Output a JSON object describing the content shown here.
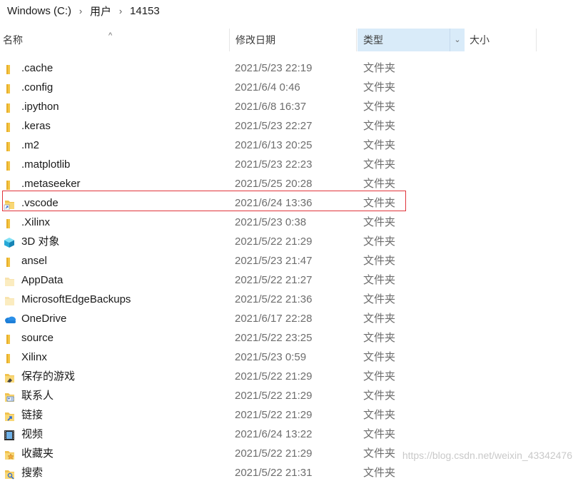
{
  "breadcrumb": [
    "Windows (C:)",
    "用户",
    "14153"
  ],
  "breadcrumb_sep": "›",
  "columns": {
    "name": "名称",
    "date": "修改日期",
    "type": "类型",
    "size": "大小"
  },
  "sort_caret": "^",
  "dropdown_glyph": "⌄",
  "rows": [
    {
      "name": ".cache",
      "date": "2021/5/23 22:19",
      "type": "文件夹",
      "icon": "folder-icon"
    },
    {
      "name": ".config",
      "date": "2021/6/4 0:46",
      "type": "文件夹",
      "icon": "folder-icon"
    },
    {
      "name": ".ipython",
      "date": "2021/6/8 16:37",
      "type": "文件夹",
      "icon": "folder-icon"
    },
    {
      "name": ".keras",
      "date": "2021/5/23 22:27",
      "type": "文件夹",
      "icon": "folder-icon"
    },
    {
      "name": ".m2",
      "date": "2021/6/13 20:25",
      "type": "文件夹",
      "icon": "folder-icon"
    },
    {
      "name": ".matplotlib",
      "date": "2021/5/23 22:23",
      "type": "文件夹",
      "icon": "folder-icon"
    },
    {
      "name": ".metaseeker",
      "date": "2021/5/25 20:28",
      "type": "文件夹",
      "icon": "folder-icon"
    },
    {
      "name": ".vscode",
      "date": "2021/6/24 13:36",
      "type": "文件夹",
      "icon": "folder-shortcut-icon"
    },
    {
      "name": ".Xilinx",
      "date": "2021/5/23 0:38",
      "type": "文件夹",
      "icon": "folder-icon"
    },
    {
      "name": "3D 对象",
      "date": "2021/5/22 21:29",
      "type": "文件夹",
      "icon": "3d-objects-icon"
    },
    {
      "name": "ansel",
      "date": "2021/5/23 21:47",
      "type": "文件夹",
      "icon": "folder-icon"
    },
    {
      "name": "AppData",
      "date": "2021/5/22 21:27",
      "type": "文件夹",
      "icon": "hidden-folder-icon"
    },
    {
      "name": "MicrosoftEdgeBackups",
      "date": "2021/5/22 21:36",
      "type": "文件夹",
      "icon": "hidden-folder-icon"
    },
    {
      "name": "OneDrive",
      "date": "2021/6/17 22:28",
      "type": "文件夹",
      "icon": "onedrive-icon"
    },
    {
      "name": "source",
      "date": "2021/5/22 23:25",
      "type": "文件夹",
      "icon": "folder-icon"
    },
    {
      "name": "Xilinx",
      "date": "2021/5/23 0:59",
      "type": "文件夹",
      "icon": "folder-icon"
    },
    {
      "name": "保存的游戏",
      "date": "2021/5/22 21:29",
      "type": "文件夹",
      "icon": "saved-games-icon"
    },
    {
      "name": "联系人",
      "date": "2021/5/22 21:29",
      "type": "文件夹",
      "icon": "contacts-icon"
    },
    {
      "name": "链接",
      "date": "2021/5/22 21:29",
      "type": "文件夹",
      "icon": "links-icon"
    },
    {
      "name": "视频",
      "date": "2021/6/24 13:22",
      "type": "文件夹",
      "icon": "videos-icon"
    },
    {
      "name": "收藏夹",
      "date": "2021/5/22 21:29",
      "type": "文件夹",
      "icon": "favorites-icon"
    },
    {
      "name": "搜索",
      "date": "2021/5/22 21:31",
      "type": "文件夹",
      "icon": "searches-icon"
    }
  ],
  "highlighted_row": ".vscode",
  "watermark": "https://blog.csdn.net/weixin_43342476"
}
